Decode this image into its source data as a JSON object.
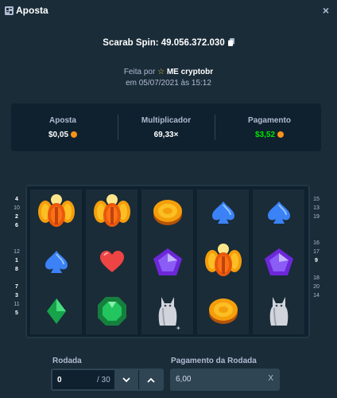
{
  "window": {
    "title": "Aposta",
    "close_label": "×"
  },
  "spin": {
    "title": "Scarab Spin: 49.056.372.030",
    "made_by_prefix": "Feita por",
    "user": "ME cryptobr",
    "date": "em 05/07/2021 às 15:12"
  },
  "stats": {
    "bet_label": "Aposta",
    "bet_value": "$0,05",
    "multiplier_label": "Multiplicador",
    "multiplier_value": "69,33×",
    "payout_label": "Pagamento",
    "payout_value": "$3,52"
  },
  "reels": {
    "columns": [
      [
        "scarab",
        "blue-spade",
        "green-diamond"
      ],
      [
        "scarab",
        "red-heart",
        "green-gem"
      ],
      [
        "gold-coin",
        "purple-pentagon",
        "silver-cat"
      ],
      [
        "blue-spade",
        "scarab",
        "gold-coin"
      ],
      [
        "blue-spade",
        "purple-pentagon",
        "silver-cat"
      ]
    ],
    "paylines_left": [
      "4",
      "10",
      "2",
      "6",
      "",
      "",
      "12",
      "1",
      "8",
      "",
      "7",
      "3",
      "11",
      "5"
    ],
    "paylines_right": [
      "15",
      "13",
      "19",
      "",
      "",
      "16",
      "17",
      "9",
      "",
      "18",
      "20",
      "14"
    ]
  },
  "round": {
    "label": "Rodada",
    "value": "0",
    "total": "/ 30"
  },
  "round_payout": {
    "label": "Pagamento da Rodada",
    "value": "6,00",
    "clear": "X"
  },
  "colors": {
    "payout": "#00e701",
    "coin": "#f7931a",
    "background": "#1a2c38"
  }
}
